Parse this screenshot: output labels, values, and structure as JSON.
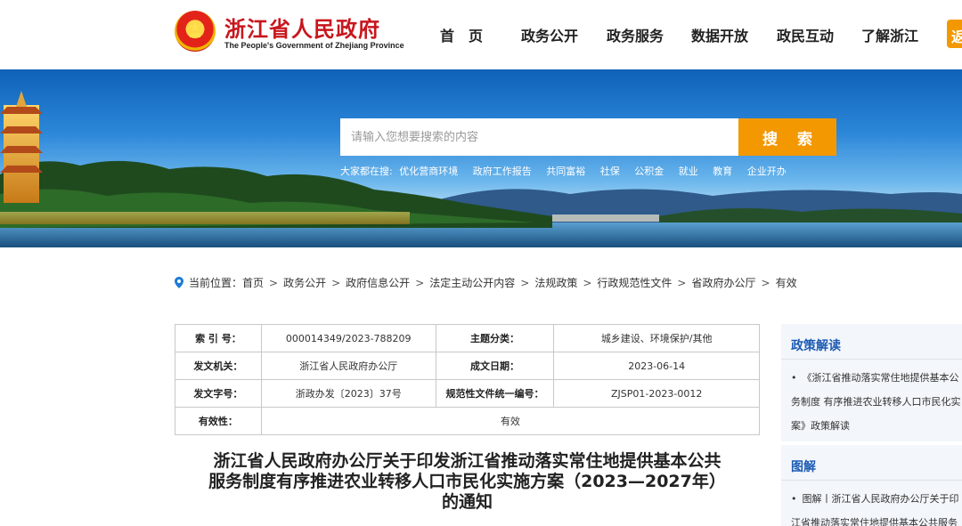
{
  "header": {
    "site_title": "浙江省人民政府",
    "site_subtitle": "The People's Government of Zhejiang Province",
    "nav": [
      "首　页",
      "政务公开",
      "政务服务",
      "数据开放",
      "政民互动",
      "了解浙江"
    ],
    "nav_extra": "返"
  },
  "search": {
    "placeholder": "请输入您想要搜索的内容",
    "button_label": "搜 索",
    "hot_label": "大家都在搜:",
    "hot_terms": [
      "优化营商环境",
      "政府工作报告",
      "共同富裕",
      "社保",
      "公积金",
      "就业",
      "教育",
      "企业开办"
    ]
  },
  "breadcrumb": {
    "label": "当前位置：",
    "items": [
      "首页",
      "政务公开",
      "政府信息公开",
      "法定主动公开内容",
      "法规政策",
      "行政规范性文件",
      "省政府办公厅",
      "有效"
    ],
    "separator": ">"
  },
  "meta": {
    "index_label": "索 引 号：",
    "index_value": "000014349/2023-788209",
    "topic_label": "主题分类：",
    "topic_value": "城乡建设、环境保护/其他",
    "issuer_label": "发文机关：",
    "issuer_value": "浙江省人民政府办公厅",
    "date_label": "成文日期：",
    "date_value": "2023-06-14",
    "docno_label": "发文字号：",
    "docno_value": "浙政办发〔2023〕37号",
    "code_label": "规范性文件统一编号：",
    "code_value": "ZJSP01-2023-0012",
    "validity_label": "有效性：",
    "validity_value": "有效"
  },
  "document": {
    "title_line1": "浙江省人民政府办公厅关于印发浙江省推动落实常住地提供基本公共",
    "title_line2": "服务制度有序推进农业转移人口市民化实施方案（2023—2027年）",
    "title_line3": "的通知"
  },
  "sidebar": {
    "policy_head": "政策解读",
    "policy_item_line1": "《浙江省推动落实常住地提供基本公",
    "policy_item_line2": "务制度 有序推进农业转移人口市民化实",
    "policy_item_line3": "案》政策解读",
    "graphic_head": "图解",
    "graphic_item_line1": "图解丨浙江省人民政府办公厅关于印",
    "graphic_item_line2": "江省推动落实常住地提供基本公共服务"
  },
  "colors": {
    "accent_red": "#c8161d",
    "accent_orange": "#f39800",
    "link_blue": "#1c5bb5"
  }
}
